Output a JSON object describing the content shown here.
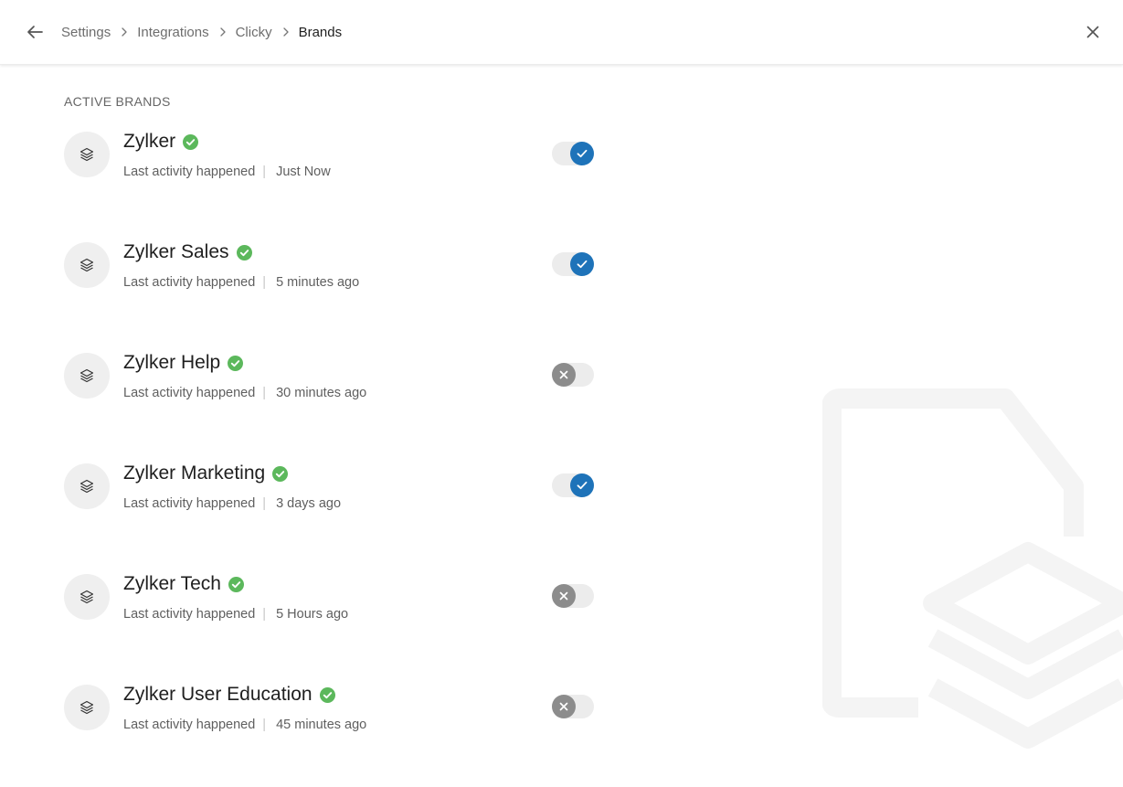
{
  "header": {
    "breadcrumbs": [
      "Settings",
      "Integrations",
      "Clicky",
      "Brands"
    ]
  },
  "section_title": "ACTIVE BRANDS",
  "brands": [
    {
      "name": "Zylker",
      "activity_label": "Last activity happened",
      "activity_time": "Just Now",
      "enabled": true
    },
    {
      "name": "Zylker Sales",
      "activity_label": "Last activity happened",
      "activity_time": "5 minutes ago",
      "enabled": true
    },
    {
      "name": "Zylker Help",
      "activity_label": "Last activity happened",
      "activity_time": "30 minutes ago",
      "enabled": false
    },
    {
      "name": "Zylker Marketing",
      "activity_label": "Last activity happened",
      "activity_time": "3 days ago",
      "enabled": true
    },
    {
      "name": "Zylker Tech",
      "activity_label": "Last activity happened",
      "activity_time": "5 Hours ago",
      "enabled": false
    },
    {
      "name": "Zylker User Education",
      "activity_label": "Last activity happened",
      "activity_time": "45 minutes ago",
      "enabled": false
    }
  ],
  "icons": {
    "back": "arrow-left-icon",
    "close": "close-icon",
    "breadcrumb_separator": "chevron-right-icon",
    "brand": "layers-icon",
    "verified": "check-circle-icon",
    "toggle_on": "check-icon",
    "toggle_off": "x-icon",
    "watermark": "document-layers-icon"
  },
  "colors": {
    "toggle_on": "#1e73b9",
    "toggle_off": "#8c8c8c",
    "verified": "#5cb85c",
    "watermark": "#f4f4f4"
  }
}
